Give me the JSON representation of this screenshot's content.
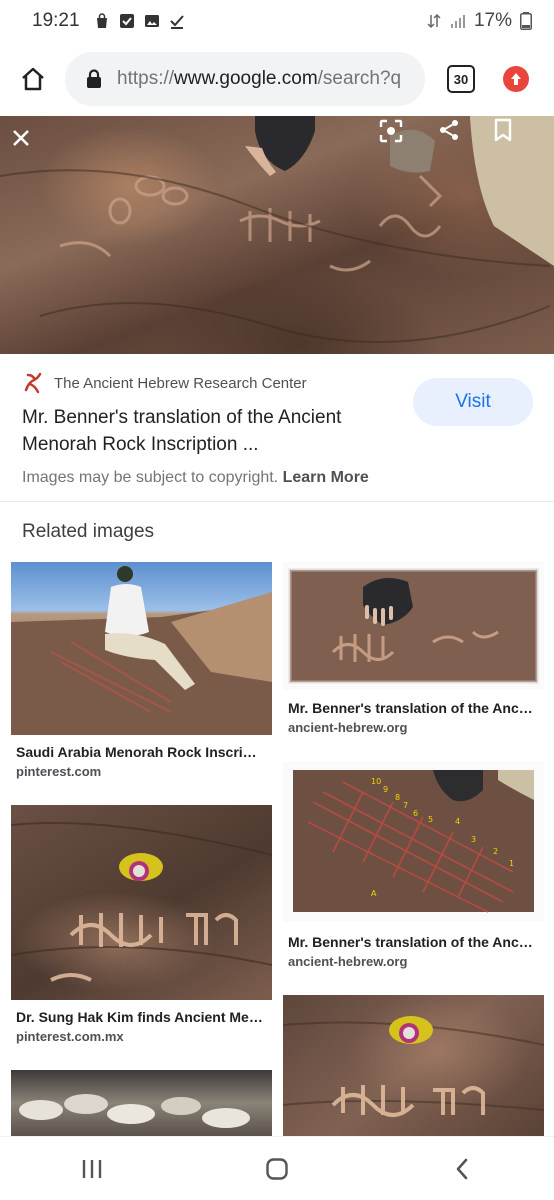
{
  "status_bar": {
    "time": "19:21",
    "battery": "17%",
    "left_icons": [
      "bag-icon",
      "checkbox-icon",
      "image-icon",
      "download-done-icon"
    ],
    "right_icons": [
      "data-arrows-icon",
      "signal-icon",
      "battery-icon"
    ]
  },
  "browser": {
    "url_prefix": "https://",
    "url_host": "www.google.com",
    "url_path": "/search?q",
    "tab_count": "30",
    "accent": "#e8453c"
  },
  "hero": {
    "actions": [
      "close-icon",
      "lens-icon",
      "share-icon",
      "bookmark-icon"
    ]
  },
  "result": {
    "source_name": "The Ancient Hebrew Research Center",
    "title": "Mr. Benner's translation of the Ancient Menorah Rock Inscription ...",
    "visit_label": "Visit",
    "copyright_text": "Images may be subject to copyright.",
    "learn_more": "Learn More"
  },
  "related": {
    "heading": "Related images",
    "left": [
      {
        "caption": "Saudi Arabia Menorah Rock Inscri…",
        "domain": "pinterest.com"
      },
      {
        "caption": "Dr. Sung Hak Kim finds Ancient Me…",
        "domain": "pinterest.com.mx"
      },
      {
        "caption": "",
        "domain": ""
      }
    ],
    "right": [
      {
        "caption": "Mr. Benner's translation of the Anc…",
        "domain": "ancient-hebrew.org"
      },
      {
        "caption": "Mr. Benner's translation of the Anc…",
        "domain": "ancient-hebrew.org"
      },
      {
        "caption": "",
        "domain": ""
      }
    ]
  },
  "nav": {
    "buttons": [
      "recents-icon",
      "home-icon",
      "back-icon"
    ]
  }
}
